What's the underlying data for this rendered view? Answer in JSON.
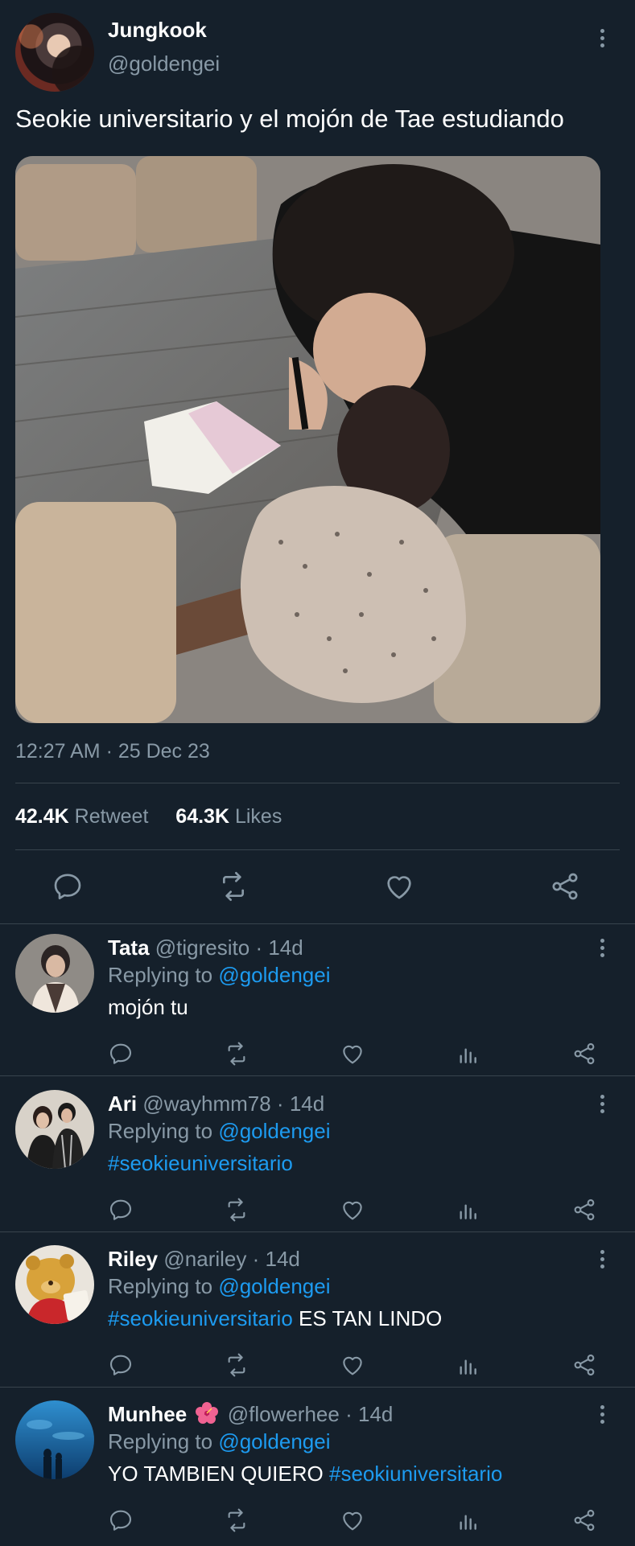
{
  "tweet": {
    "author_name": "Jungkook",
    "author_handle": "@goldengei",
    "text": "Seokie universitario y el mojón de Tae estudiando",
    "time": "12:27 AM · 25 Dec 23",
    "retweets_count": "42.4K",
    "retweets_label": "Retweet",
    "likes_count": "64.3K",
    "likes_label": "Likes"
  },
  "replies": [
    {
      "name": "Tata",
      "handle": "@tigresito",
      "age": "14d",
      "replying_prefix": "Replying to",
      "replying_handle": "@goldengei",
      "text": "mojón tu",
      "hashtag": ""
    },
    {
      "name": "Ari",
      "handle": "@wayhmm78",
      "age": "14d",
      "replying_prefix": "Replying to",
      "replying_handle": "@goldengei",
      "hashtag": "#seokieuniversitario",
      "text": ""
    },
    {
      "name": "Riley",
      "handle": "@nariley",
      "age": "14d",
      "replying_prefix": "Replying to",
      "replying_handle": "@goldengei",
      "hashtag": "#seokieuniversitario",
      "text": "ES TAN LINDO"
    },
    {
      "name": "Munhee",
      "handle": "@flowerhee",
      "age": "14d",
      "replying_prefix": "Replying to",
      "replying_handle": "@goldengei",
      "text": "YO TAMBIEN QUIERO",
      "hashtag": "#seokiuniversitario"
    }
  ],
  "icons": [
    "reply-icon",
    "retweet-icon",
    "like-icon",
    "share-icon",
    "views-icon",
    "more-icon",
    "hibiscus-emoji"
  ],
  "colors": {
    "background": "#15202b",
    "muted": "#8899a6",
    "link": "#1d9bf0",
    "divider": "#38444d"
  }
}
